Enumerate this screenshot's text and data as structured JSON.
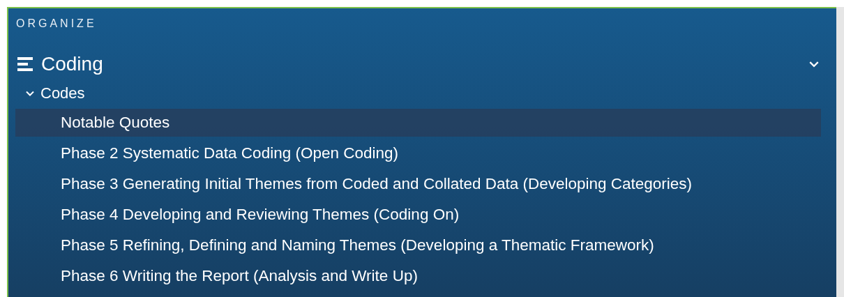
{
  "heading": "ORGANIZE",
  "section": {
    "title": "Coding",
    "expanded": true,
    "group": {
      "label": "Codes",
      "expanded": true,
      "items": [
        {
          "label": "Notable Quotes",
          "selected": true
        },
        {
          "label": "Phase 2 Systematic Data Coding (Open Coding)",
          "selected": false
        },
        {
          "label": "Phase 3 Generating Initial Themes from Coded and Collated Data (Developing Categories)",
          "selected": false
        },
        {
          "label": "Phase 4 Developing and Reviewing Themes (Coding On)",
          "selected": false
        },
        {
          "label": "Phase 5 Refining, Defining and Naming Themes (Developing a Thematic Framework)",
          "selected": false
        },
        {
          "label": "Phase 6 Writing the Report (Analysis and Write Up)",
          "selected": false
        }
      ]
    }
  }
}
